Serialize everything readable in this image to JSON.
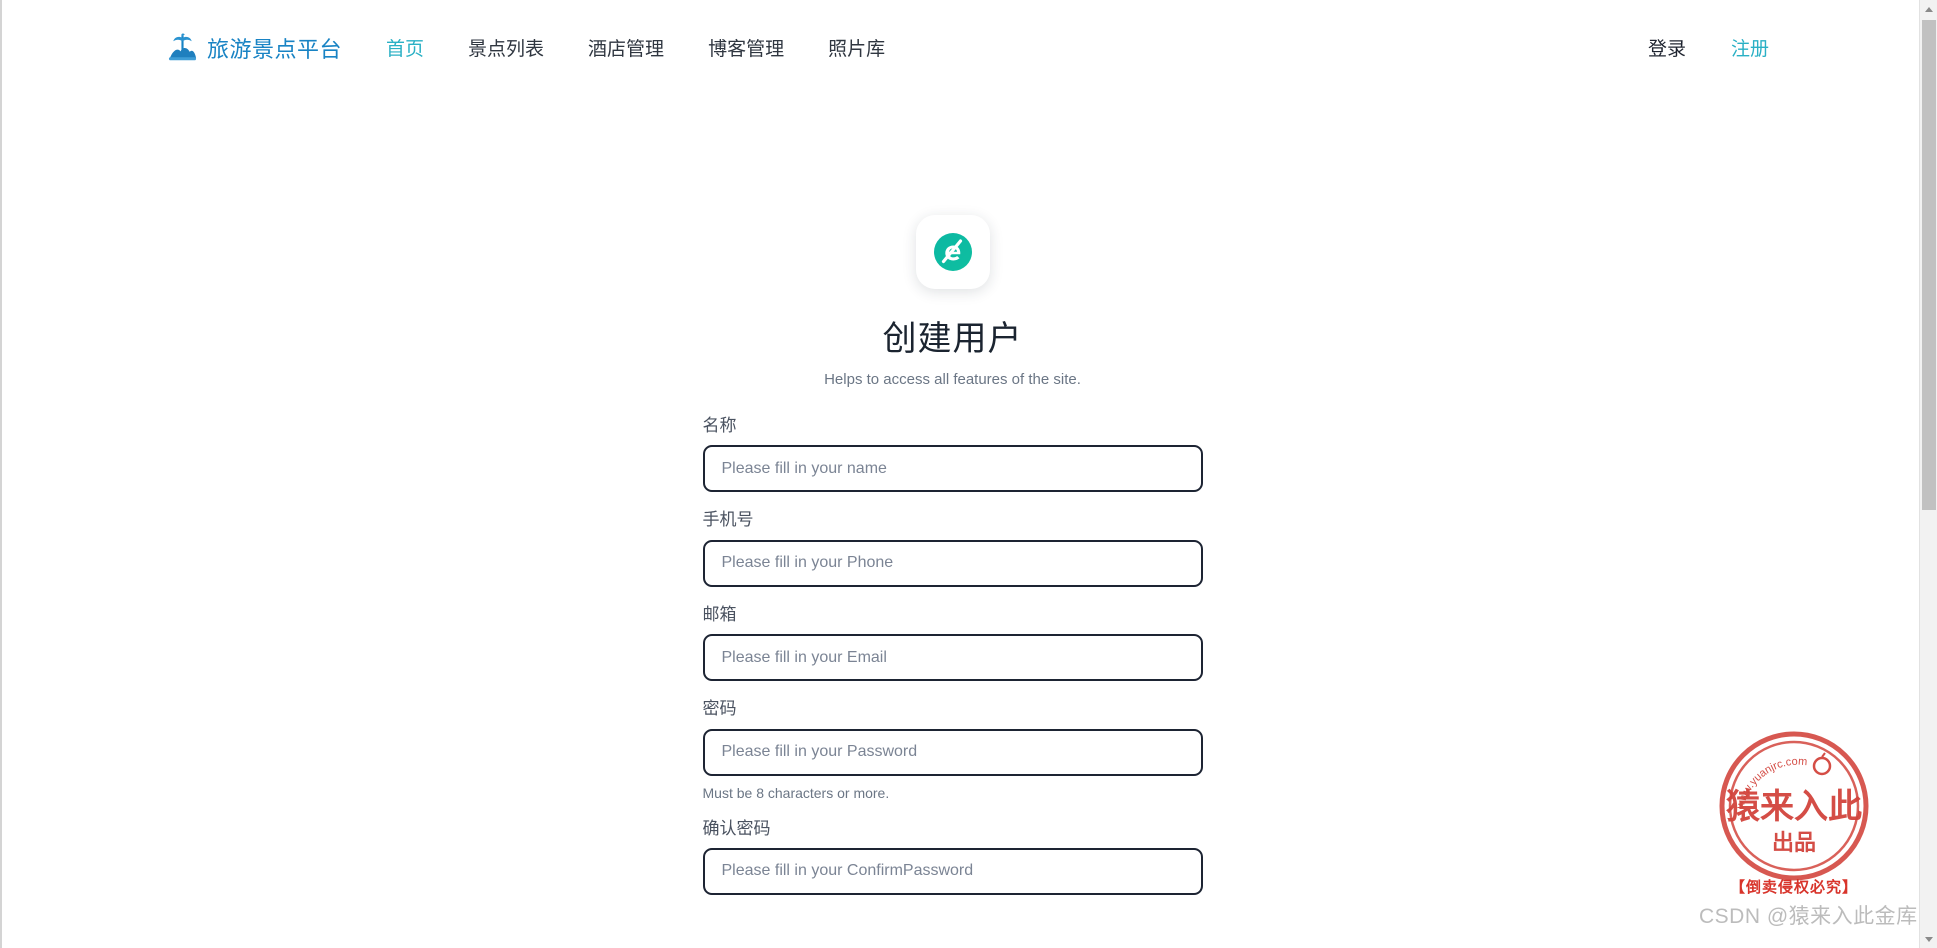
{
  "header": {
    "brand": {
      "icon": "island-palm-icon",
      "text": "旅游景点平台",
      "color": "#1883c4"
    },
    "nav_items": [
      {
        "label": "首页",
        "active": true
      },
      {
        "label": "景点列表",
        "active": false
      },
      {
        "label": "酒店管理",
        "active": false
      },
      {
        "label": "博客管理",
        "active": false
      },
      {
        "label": "照片库",
        "active": false
      }
    ],
    "auth": {
      "login_label": "登录",
      "register_label": "注册",
      "login_color": "#1f2430",
      "register_color": "#2ab0c5"
    }
  },
  "card": {
    "logo_icon": "teal-circle-e-logo",
    "logo_color": "#0ab5a0",
    "title": "创建用户",
    "subtitle": "Helps to access all features of the site."
  },
  "form": {
    "fields": [
      {
        "name": "name",
        "label": "名称",
        "placeholder": "Please fill in your name",
        "value": "",
        "type": "text",
        "help": ""
      },
      {
        "name": "phone",
        "label": "手机号",
        "placeholder": "Please fill in your Phone",
        "value": "",
        "type": "text",
        "help": ""
      },
      {
        "name": "email",
        "label": "邮箱",
        "placeholder": "Please fill in your Email",
        "value": "",
        "type": "text",
        "help": ""
      },
      {
        "name": "password",
        "label": "密码",
        "placeholder": "Please fill in your Password",
        "value": "",
        "type": "password",
        "help": "Must be 8 characters or more."
      },
      {
        "name": "confirm-password",
        "label": "确认密码",
        "placeholder": "Please fill in your ConfirmPassword",
        "value": "",
        "type": "password",
        "help": ""
      }
    ]
  },
  "scrollbar": {
    "up_arrow": "scroll-up-arrow-icon",
    "down_arrow": "scroll-down-arrow-icon"
  },
  "watermark": {
    "stamp_url_text": "www.yuanjrc.com",
    "stamp_main": "猿来入此",
    "stamp_sub": "出品",
    "warning": "【倒卖侵权必究】",
    "csdn": "CSDN @猿来入此金库",
    "stamp_color": "#cc2b22"
  }
}
